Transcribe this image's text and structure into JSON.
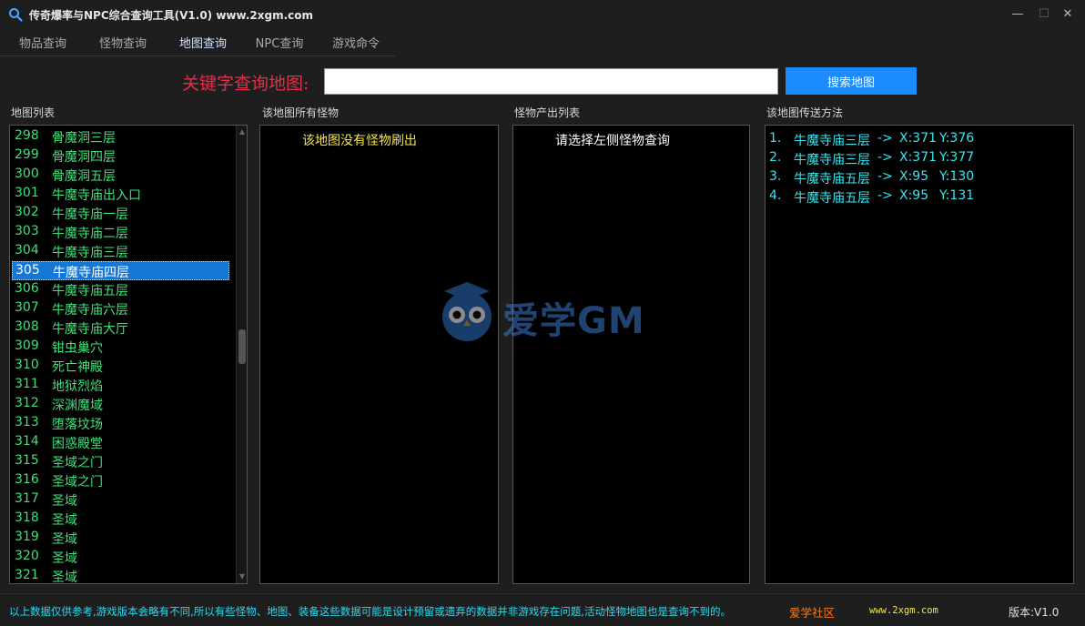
{
  "window": {
    "title": "传奇爆率与NPC综合查询工具(V1.0)   www.2xgm.com",
    "controls": {
      "minimize": "—",
      "maximize": "☐",
      "close": "✕"
    }
  },
  "tabs": [
    "物品查询",
    "怪物查询",
    "地图查询",
    "NPC查询",
    "游戏命令"
  ],
  "active_tab": "地图查询",
  "search": {
    "label": "关键字查询地图:",
    "value": "",
    "button": "搜索地图"
  },
  "map_list": {
    "header": "地图列表",
    "selected": "305",
    "items": [
      {
        "num": "298",
        "name": "骨魔洞三层"
      },
      {
        "num": "299",
        "name": "骨魔洞四层"
      },
      {
        "num": "300",
        "name": "骨魔洞五层"
      },
      {
        "num": "301",
        "name": "牛魔寺庙出入口"
      },
      {
        "num": "302",
        "name": "牛魔寺庙一层"
      },
      {
        "num": "303",
        "name": "牛魔寺庙二层"
      },
      {
        "num": "304",
        "name": "牛魔寺庙三层"
      },
      {
        "num": "305",
        "name": "牛魔寺庙四层"
      },
      {
        "num": "306",
        "name": "牛魔寺庙五层"
      },
      {
        "num": "307",
        "name": "牛魔寺庙六层"
      },
      {
        "num": "308",
        "name": "牛魔寺庙大厅"
      },
      {
        "num": "309",
        "name": "钳虫巢穴"
      },
      {
        "num": "310",
        "name": "死亡神殿"
      },
      {
        "num": "311",
        "name": "地狱烈焰"
      },
      {
        "num": "312",
        "name": "深渊魔域"
      },
      {
        "num": "313",
        "name": "堕落坟场"
      },
      {
        "num": "314",
        "name": "困惑殿堂"
      },
      {
        "num": "315",
        "name": "圣域之门"
      },
      {
        "num": "316",
        "name": "圣域之门"
      },
      {
        "num": "317",
        "name": "圣域"
      },
      {
        "num": "318",
        "name": "圣域"
      },
      {
        "num": "319",
        "name": "圣域"
      },
      {
        "num": "320",
        "name": "圣域"
      },
      {
        "num": "321",
        "name": "圣域"
      }
    ],
    "scroll_position": 0.48
  },
  "monsters": {
    "header": "该地图所有怪物",
    "message": "该地图没有怪物刷出"
  },
  "drops": {
    "header": "怪物产出列表",
    "message": "请选择左侧怪物查询"
  },
  "teleports": {
    "header": "该地图传送方法",
    "items": [
      {
        "idx": "1.",
        "name": "牛魔寺庙三层",
        "arrow": "->",
        "x": "X:371",
        "y": "Y:376"
      },
      {
        "idx": "2.",
        "name": "牛魔寺庙三层",
        "arrow": "->",
        "x": "X:371",
        "y": "Y:377"
      },
      {
        "idx": "3.",
        "name": "牛魔寺庙五层",
        "arrow": "->",
        "x": "X:95",
        "y": "Y:130"
      },
      {
        "idx": "4.",
        "name": "牛魔寺庙五层",
        "arrow": "->",
        "x": "X:95",
        "y": "Y:131"
      }
    ]
  },
  "watermark": {
    "text": "爱学GM"
  },
  "status": {
    "note": "以上数据仅供参考,游戏版本会略有不同,所以有些怪物、地图、装备这些数据可能是设计预留或遗弃的数据并非游戏存在问题,活动怪物地图也是查询不到的。",
    "link": "爱学社区",
    "url": "www.2xgm.com",
    "version": "版本:V1.0"
  },
  "colors": {
    "accent": "#1a8cff",
    "selection": "#1577d6",
    "map_text": "#3fe07c",
    "teleport_text": "#33e7f0",
    "search_label": "#e0304b"
  }
}
